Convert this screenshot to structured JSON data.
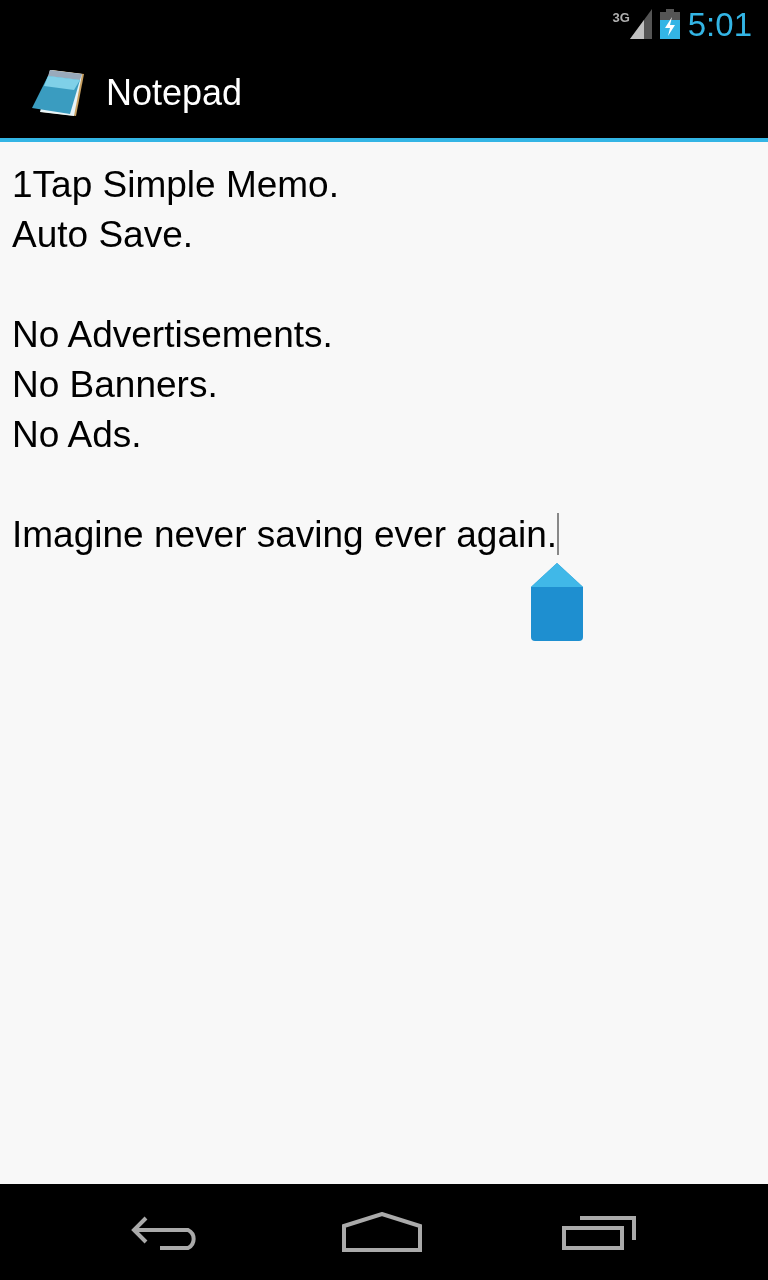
{
  "status_bar": {
    "network_type": "3G",
    "time": "5:01"
  },
  "action_bar": {
    "title": "Notepad"
  },
  "note": {
    "paragraphs": [
      [
        "1Tap Simple Memo.",
        "Auto Save."
      ],
      [
        "No Advertisements.",
        "No Banners.",
        "No Ads."
      ],
      [
        "Imagine never saving ever again."
      ]
    ],
    "text_cursor": {
      "visible": true
    }
  },
  "nav_bar": {
    "buttons": [
      {
        "kind": "back"
      },
      {
        "kind": "home"
      },
      {
        "kind": "recents"
      }
    ]
  }
}
